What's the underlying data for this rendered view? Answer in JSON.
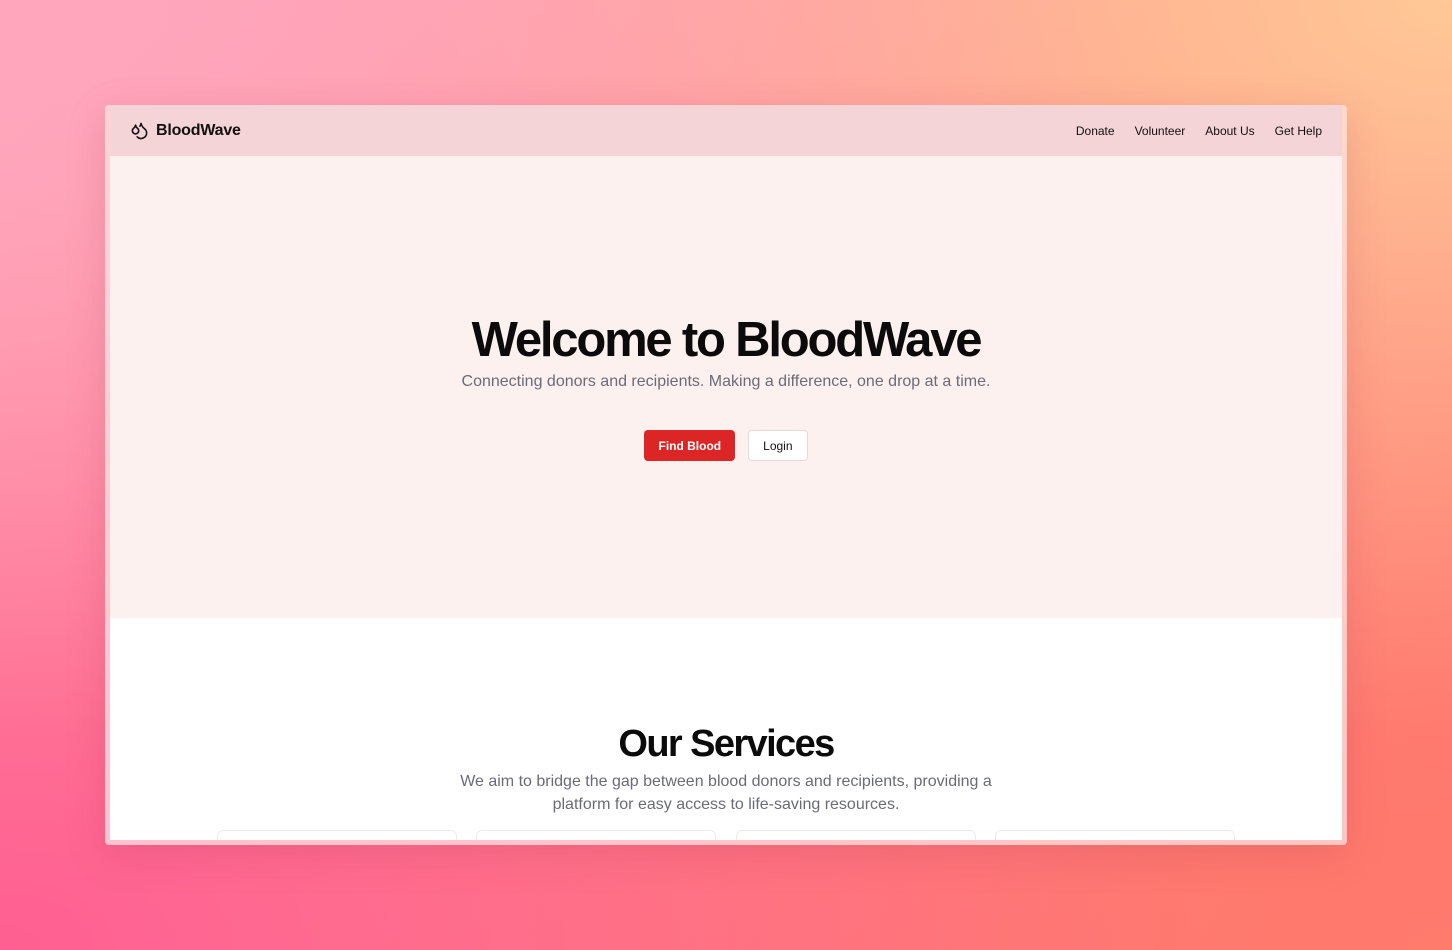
{
  "navbar": {
    "brand_icon": "blood-drops-icon",
    "brand_name": "BloodWave",
    "links": [
      {
        "label": "Donate"
      },
      {
        "label": "Volunteer"
      },
      {
        "label": "About Us"
      },
      {
        "label": "Get Help"
      }
    ]
  },
  "hero": {
    "title": "Welcome to BloodWave",
    "subtitle": "Connecting donors and recipients. Making a difference, one drop at a time.",
    "primary_button": "Find Blood",
    "secondary_button": "Login"
  },
  "services": {
    "title": "Our Services",
    "subtitle": "We aim to bridge the gap between blood donors and recipients, providing a platform for easy access to life-saving resources.",
    "card_count_visible": 4
  },
  "colors": {
    "accent": "#dc2626",
    "navbar_bg": "#f4d4d6",
    "hero_bg": "#fcf1ef",
    "muted_text": "#6b6b78"
  }
}
